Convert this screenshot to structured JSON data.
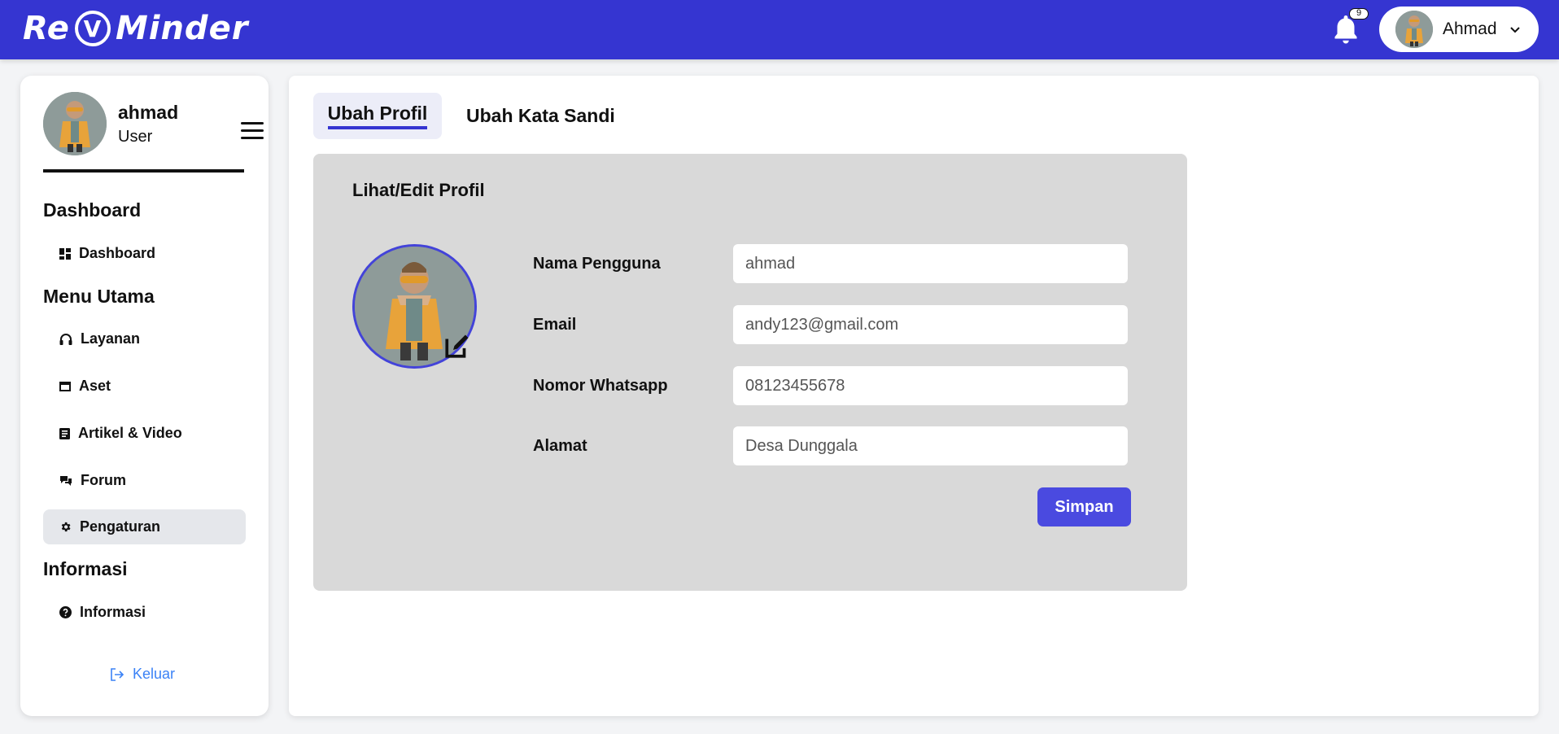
{
  "header": {
    "logo_text_left": "Re",
    "logo_text_mark": "V",
    "logo_text_right": "Minder",
    "notification_count": "9",
    "user_name": "Ahmad",
    "accent_color": "#3535d1"
  },
  "sidebar": {
    "user_name": "ahmad",
    "user_role": "User",
    "sections": [
      {
        "title": "Dashboard"
      },
      {
        "title": "Menu Utama"
      },
      {
        "title": "Informasi"
      }
    ],
    "items": [
      {
        "label": "Dashboard",
        "icon": "dashboard-grid-icon"
      },
      {
        "label": "Layanan",
        "icon": "headphones-icon"
      },
      {
        "label": "Aset",
        "icon": "window-icon"
      },
      {
        "label": "Artikel & Video",
        "icon": "article-icon"
      },
      {
        "label": "Forum",
        "icon": "chat-bubbles-icon"
      },
      {
        "label": "Pengaturan",
        "icon": "gear-icon",
        "active": true
      },
      {
        "label": "Informasi",
        "icon": "question-circle-icon"
      }
    ],
    "logout_label": "Keluar"
  },
  "main": {
    "tabs": [
      {
        "label": "Ubah Profil",
        "active": true
      },
      {
        "label": "Ubah Kata Sandi",
        "active": false
      }
    ],
    "card": {
      "title": "Lihat/Edit Profil",
      "fields": [
        {
          "label": "Nama Pengguna",
          "value": "ahmad"
        },
        {
          "label": "Email",
          "value": "andy123@gmail.com"
        },
        {
          "label": "Nomor Whatsapp",
          "value": "08123455678"
        },
        {
          "label": "Alamat",
          "value": "Desa Dunggala"
        }
      ],
      "save_label": "Simpan"
    }
  }
}
